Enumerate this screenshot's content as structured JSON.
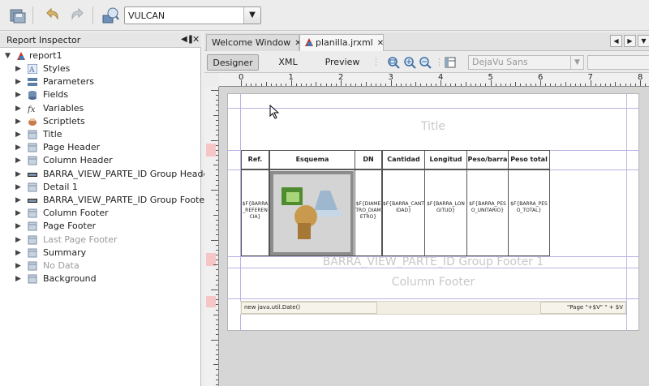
{
  "toolbar": {
    "datasource": "VULCAN",
    "icons": [
      "save-all-icon",
      "undo-icon",
      "redo-icon",
      "datasource-icon"
    ]
  },
  "inspector": {
    "title": "Report Inspector",
    "root": "report1",
    "items": [
      {
        "label": "Styles",
        "icon": "styles-icon",
        "dim": false
      },
      {
        "label": "Parameters",
        "icon": "parameters-icon",
        "dim": false
      },
      {
        "label": "Fields",
        "icon": "fields-icon",
        "dim": false
      },
      {
        "label": "Variables",
        "icon": "variables-icon",
        "dim": false
      },
      {
        "label": "Scriptlets",
        "icon": "scriptlets-icon",
        "dim": false
      },
      {
        "label": "Title",
        "icon": "band-icon",
        "dim": false
      },
      {
        "label": "Page Header",
        "icon": "band-icon",
        "dim": false
      },
      {
        "label": "Column Header",
        "icon": "band-icon",
        "dim": false
      },
      {
        "label": "BARRA_VIEW_PARTE_ID Group Header",
        "icon": "group-icon",
        "dim": false
      },
      {
        "label": "Detail 1",
        "icon": "band-icon",
        "dim": false
      },
      {
        "label": "BARRA_VIEW_PARTE_ID Group Footer",
        "icon": "group-icon",
        "dim": false
      },
      {
        "label": "Column Footer",
        "icon": "band-icon",
        "dim": false
      },
      {
        "label": "Page Footer",
        "icon": "band-icon",
        "dim": false
      },
      {
        "label": "Last Page Footer",
        "icon": "band-icon",
        "dim": true
      },
      {
        "label": "Summary",
        "icon": "band-icon",
        "dim": false
      },
      {
        "label": "No Data",
        "icon": "band-icon",
        "dim": true
      },
      {
        "label": "Background",
        "icon": "band-icon",
        "dim": false
      }
    ]
  },
  "editor": {
    "tabs": [
      {
        "label": "Welcome Window",
        "active": false
      },
      {
        "label": "planilla.jrxml",
        "active": true
      }
    ],
    "views": [
      "Designer",
      "XML",
      "Preview"
    ],
    "font": "DejaVu Sans"
  },
  "ruler": {
    "labels": [
      "0",
      "1",
      "2",
      "3",
      "4",
      "5",
      "6",
      "7",
      "8"
    ]
  },
  "report": {
    "title_band": "Title",
    "headers": [
      "Ref.",
      "Esquema",
      "DN",
      "Cantidad",
      "Longitud",
      "Peso/barra",
      "Peso total"
    ],
    "cells": [
      "$F{BARRA_REFERENCIA}",
      "",
      "$F{DIAMETRO_DIAMETRO}",
      "$F{BARRA_CANTIDAD}",
      "$F{BARRA_LONGITUD}",
      "$F{BARRA_PESO_UNITARIO}",
      "$F{BARRA_PESO_TOTAL}"
    ],
    "group_footer_band": "BARRA_VIEW_PARTE_ID Group Footer 1",
    "column_footer_band": "Column Footer",
    "page_footer_date": "new java.util.Date()",
    "page_footer_num": "\"Page \"+$V\" \" + $V"
  }
}
